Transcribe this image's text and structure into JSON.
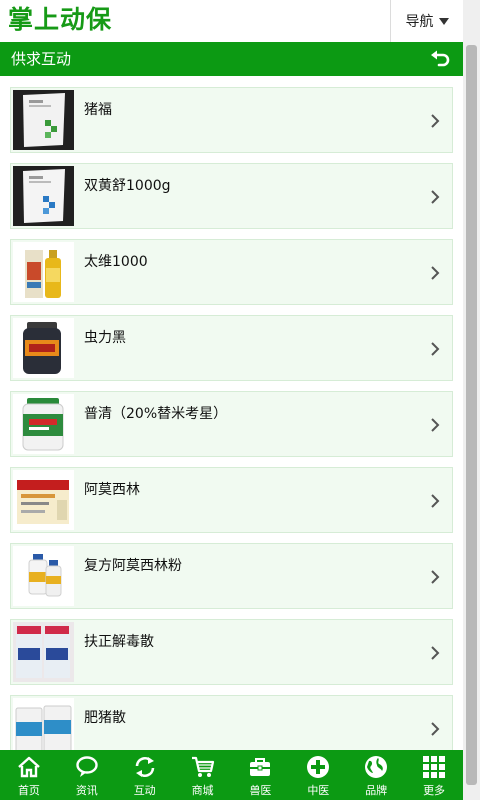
{
  "header": {
    "logo": "掌上动保",
    "nav_label": "导航"
  },
  "section": {
    "title": "供求互动"
  },
  "products": [
    {
      "name": "猪福",
      "image": "white-sachet-green-squares-photo"
    },
    {
      "name": "双黄舒1000g",
      "image": "white-sachet-blue-squares-photo"
    },
    {
      "name": "太维1000",
      "image": "yellow-bottle-with-box-photo"
    },
    {
      "name": "虫力黑",
      "image": "dark-tub-orange-label-photo"
    },
    {
      "name": "普清（20%替米考星）",
      "image": "white-tub-green-label-photo"
    },
    {
      "name": "阿莫西林",
      "image": "red-medicine-box-photo"
    },
    {
      "name": "复方阿莫西林粉",
      "image": "two-small-bottles-photo"
    },
    {
      "name": "扶正解毒散",
      "image": "clear-jars-blue-labels-photo"
    },
    {
      "name": "肥猪散",
      "image": "white-tubs-blue-label-photo"
    }
  ],
  "tabs": [
    {
      "label": "首页",
      "icon": "home-icon"
    },
    {
      "label": "资讯",
      "icon": "chat-bubble-icon"
    },
    {
      "label": "互动",
      "icon": "refresh-icon"
    },
    {
      "label": "商城",
      "icon": "cart-icon"
    },
    {
      "label": "兽医",
      "icon": "medical-kit-icon"
    },
    {
      "label": "中医",
      "icon": "plus-circle-icon"
    },
    {
      "label": "品牌",
      "icon": "globe-icon"
    },
    {
      "label": "更多",
      "icon": "grid-icon"
    }
  ],
  "colors": {
    "brand_green": "#0c9a13",
    "logo_green": "#169a16",
    "item_bg": "#f1faf1"
  }
}
